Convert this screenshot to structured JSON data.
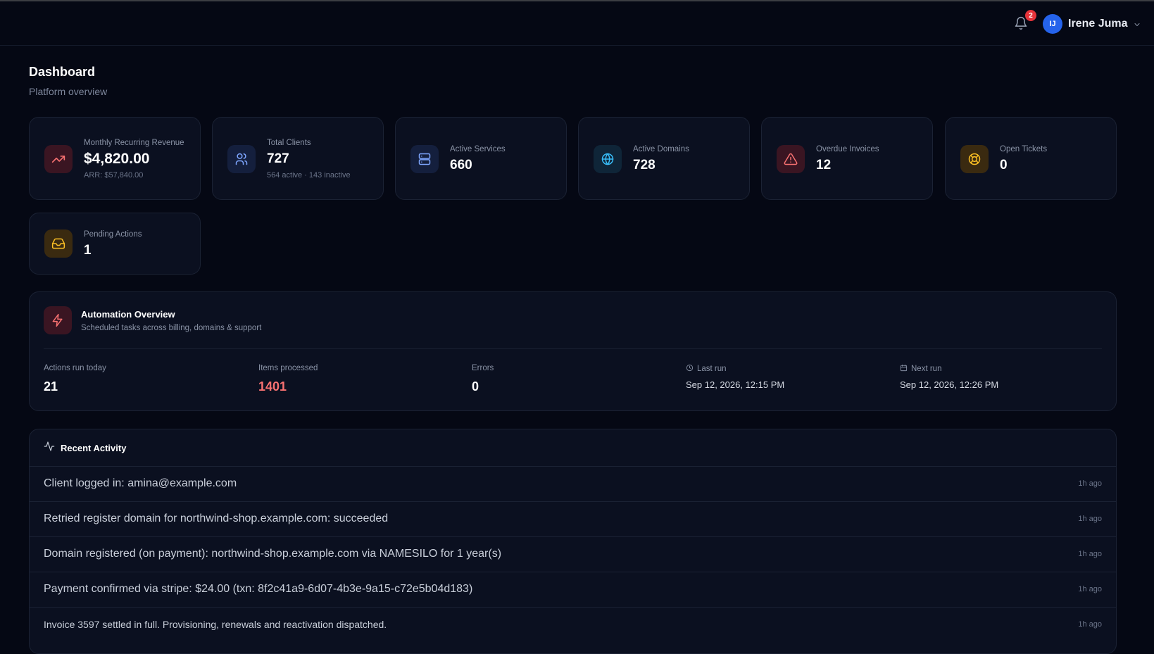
{
  "header": {
    "notifications_count": "2",
    "user": {
      "initials": "IJ",
      "name": "Irene Juma"
    }
  },
  "page": {
    "title": "Dashboard",
    "subtitle": "Platform overview"
  },
  "cards": [
    {
      "label": "Monthly Recurring Revenue",
      "value": "$4,820.00",
      "sub": "ARR: $57,840.00",
      "icon": "trending-up-icon",
      "color": "#f87171"
    },
    {
      "label": "Total Clients",
      "value": "727",
      "sub": "564 active · 143 inactive",
      "icon": "users-icon",
      "color": "#7ea6ff"
    },
    {
      "label": "Active Services",
      "value": "660",
      "icon": "server-icon",
      "color": "#7ea6ff"
    },
    {
      "label": "Active Domains",
      "value": "728",
      "icon": "globe-icon",
      "color": "#38bdf8"
    },
    {
      "label": "Overdue Invoices",
      "value": "12",
      "icon": "alert-triangle-icon",
      "color": "#f87171"
    },
    {
      "label": "Open Tickets",
      "value": "0",
      "icon": "life-buoy-icon",
      "color": "#fbbf24"
    },
    {
      "label": "Pending Actions",
      "value": "1",
      "icon": "inbox-icon",
      "color": "#fbbf24"
    }
  ],
  "automation": {
    "title": "Automation Overview",
    "subtitle": "Scheduled tasks across billing, domains & support",
    "stats": {
      "actions_label": "Actions run today",
      "actions_value": "21",
      "items_label": "Items processed",
      "items_value": "1401",
      "errors_label": "Errors",
      "errors_value": "0",
      "last_run_label": "Last run",
      "last_run_value": "Sep 12, 2026, 12:15 PM",
      "next_run_label": "Next run",
      "next_run_value": "Sep 12, 2026, 12:26 PM"
    }
  },
  "activity": {
    "title": "Recent Activity",
    "items": [
      {
        "text": "Client logged in: amina@example.com",
        "time": "1h ago"
      },
      {
        "text": "Retried register domain for northwind-shop.example.com: succeeded",
        "time": "1h ago"
      },
      {
        "text": "Domain registered (on payment): northwind-shop.example.com via NAMESILO for 1 year(s)",
        "time": "1h ago"
      },
      {
        "text": "Payment confirmed via stripe: $24.00 (txn: 8f2c41a9-6d07-4b3e-9a15-c72e5b04d183)",
        "time": "1h ago"
      },
      {
        "text": "Invoice 3597 settled in full. Provisioning, renewals and reactivation dispatched.",
        "time": "1h ago"
      }
    ]
  }
}
